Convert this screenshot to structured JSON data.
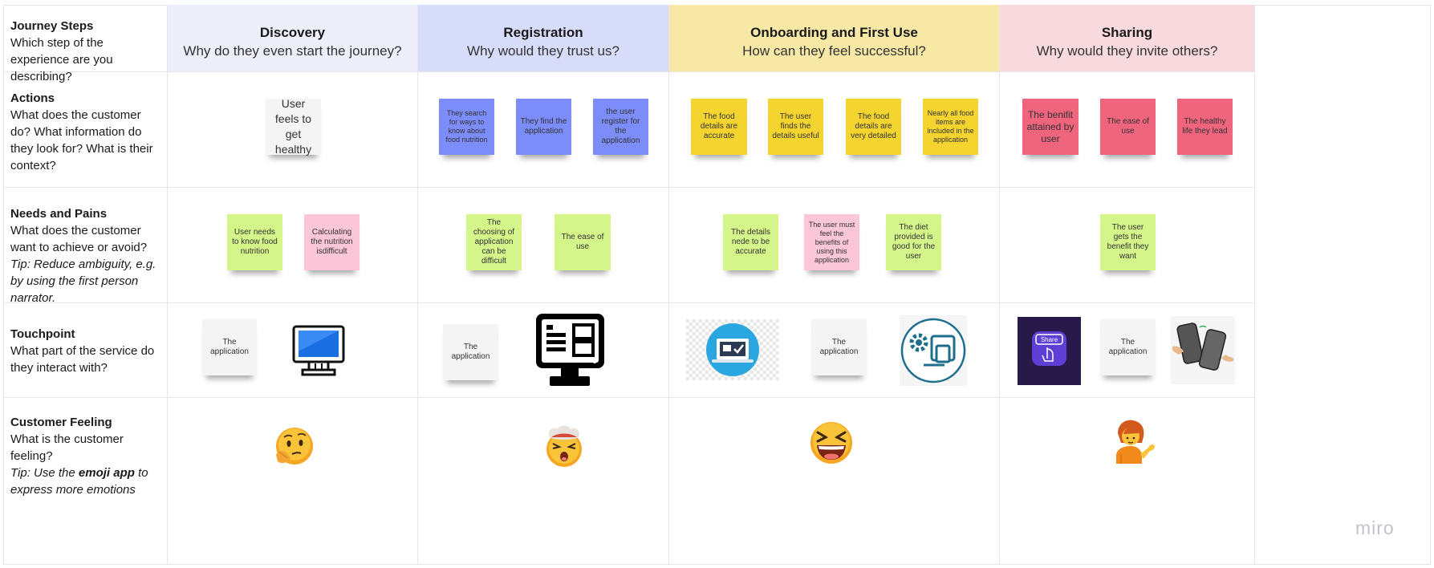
{
  "rows": [
    {
      "title": "Journey Steps",
      "desc": "Which step of the experience are you describing?",
      "tip": ""
    },
    {
      "title": "Actions",
      "desc": "What does the customer do? What information do they look for? What is their context?",
      "tip": ""
    },
    {
      "title": "Needs and Pains",
      "desc": "What does the customer want to achieve or avoid?",
      "tip": "Tip: Reduce ambiguity, e.g. by using the first person narrator."
    },
    {
      "title": "Touchpoint",
      "desc": "What part of the service do they interact with?",
      "tip": ""
    },
    {
      "title": "Customer Feeling",
      "desc": "What is the customer feeling?",
      "tip_prefix": "Tip: Use the ",
      "tip_bold": "emoji app",
      "tip_suffix": " to express more emotions"
    }
  ],
  "stages": [
    {
      "title": "Discovery",
      "subtitle": "Why do they even start the journey?",
      "color": "#eceefa"
    },
    {
      "title": "Registration",
      "subtitle": "Why would they trust us?",
      "color": "#d8dcfb"
    },
    {
      "title": "Onboarding and First Use",
      "subtitle": "How can they feel successful?",
      "color": "#f8e8a6"
    },
    {
      "title": "Sharing",
      "subtitle": "Why would they invite others?",
      "color": "#f7d9de"
    }
  ],
  "actions": [
    "User feels to get healthy",
    "They search for ways to know about food nutrition",
    "They find the application",
    "the user register for the application",
    "The food details are accurate",
    "The user finds the details useful",
    "The food details are very detailed",
    "Nearly all food items are included in the application",
    "The benifit attained by user",
    "The ease of use",
    "The healthy life they lead"
  ],
  "needs": [
    "User needs to know food nutrition",
    "Calculating the nutrition isdifficult",
    "The choosing of application can be difficult",
    "The ease of use",
    "The details nede to be accurate",
    "The user must feel the benefits of using  this application",
    "The diet provided is good for the user",
    "The user gets the benefit they want"
  ],
  "touchpoints": [
    "The application",
    "The application",
    "The application",
    "The application"
  ],
  "share_button_text": "Share",
  "watermark": "miro",
  "colors": {
    "yellow": "#f5d42f",
    "blue": "#7c8cf8",
    "green": "#d4f58a",
    "pink": "#fbc6d7",
    "red": "#f0657e",
    "white": "#f4f4f4"
  },
  "icons": [
    "monitor-icon",
    "terminal-screen-icon",
    "laptop-check-icon",
    "gear-devices-icon",
    "share-button-icon",
    "phones-icon",
    "thinking-face-emoji",
    "exploding-head-emoji",
    "grinning-squinting-emoji",
    "person-tipping-hand-emoji"
  ]
}
